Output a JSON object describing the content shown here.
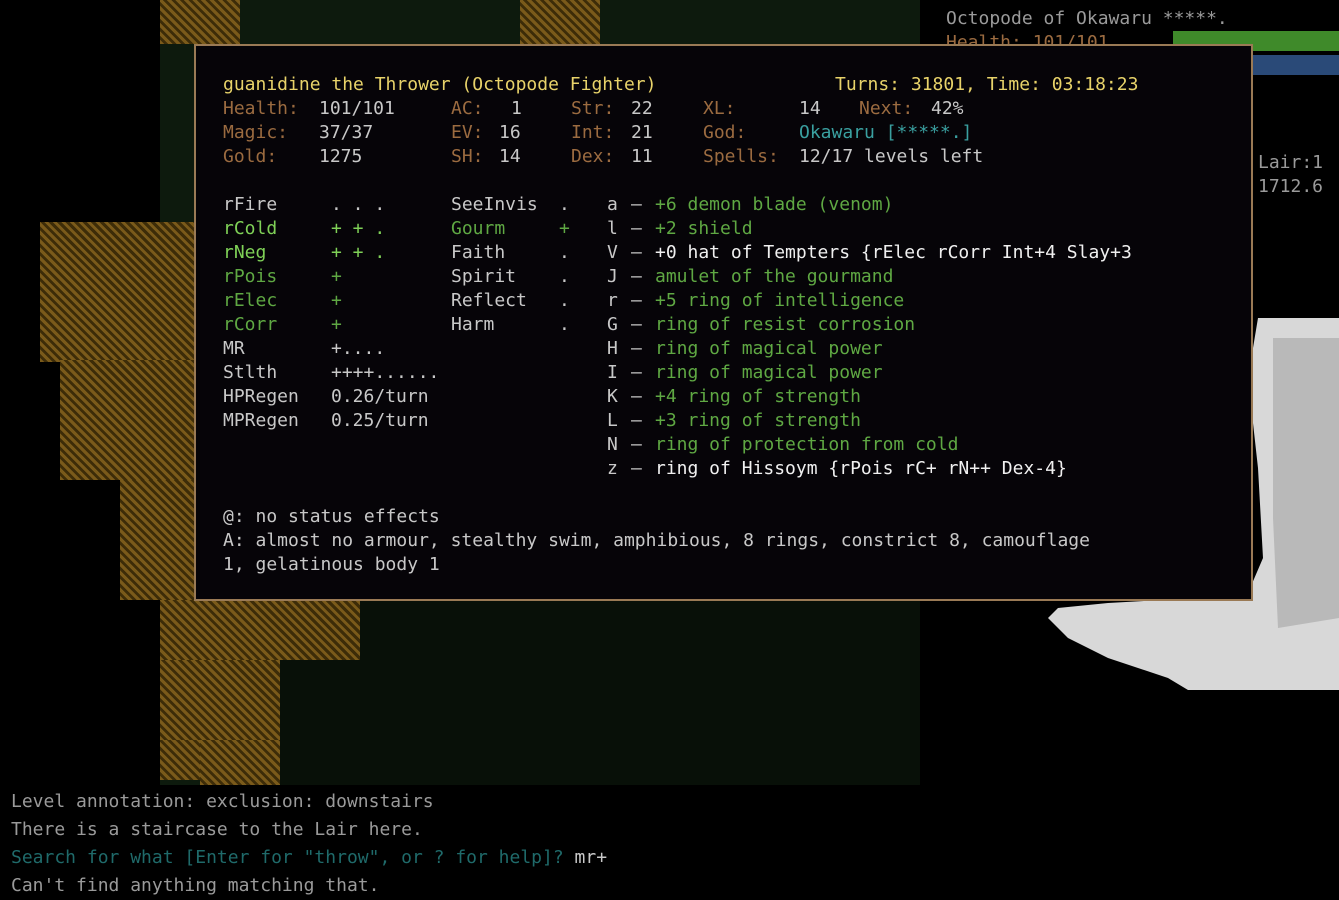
{
  "sidebar": {
    "title_line": "Octopode of Okawaru *****.",
    "health_line": "Health: 101/101",
    "place_fragment": "Lair:1",
    "time_fragment": "1712.6",
    "colors": {
      "health_bar": "#3f8a2a",
      "magic_bar": "#2a4a78"
    }
  },
  "overlay": {
    "character": "guanidine the Thrower (Octopode Fighter)",
    "turns": "Turns: 31801, Time: 03:18:23",
    "stats": {
      "health_label": "Health:",
      "health_value": "101/101",
      "magic_label": "Magic:",
      "magic_value": "37/37",
      "gold_label": "Gold:",
      "gold_value": "1275",
      "ac_label": "AC:",
      "ac_value": "1",
      "ev_label": "EV:",
      "ev_value": "16",
      "sh_label": "SH:",
      "sh_value": "14",
      "str_label": "Str:",
      "str_value": "22",
      "int_label": "Int:",
      "int_value": "21",
      "dex_label": "Dex:",
      "dex_value": "11",
      "xl_label": "XL:",
      "xl_value": "14",
      "next_label": "Next:",
      "next_value": "42%",
      "god_label": "God:",
      "god_value": "Okawaru [*****.]",
      "spells_label": "Spells:",
      "spells_value": "12/17 levels left"
    },
    "resists": [
      {
        "name": "rFire",
        "value": ". . .",
        "color": "lgray"
      },
      {
        "name": "rCold",
        "value": "+ + .",
        "color": "lgreen"
      },
      {
        "name": "rNeg",
        "value": "+ + .",
        "color": "lgreen"
      },
      {
        "name": "rPois",
        "value": "+",
        "color": "green"
      },
      {
        "name": "rElec",
        "value": "+",
        "color": "green"
      },
      {
        "name": "rCorr",
        "value": "+",
        "color": "green"
      },
      {
        "name": "MR",
        "value": "+....",
        "color": "lgray"
      },
      {
        "name": "Stlth",
        "value": "++++......",
        "color": "lgray"
      },
      {
        "name": "HPRegen",
        "value": "0.26/turn",
        "color": "lgray"
      },
      {
        "name": "MPRegen",
        "value": "0.25/turn",
        "color": "lgray"
      }
    ],
    "props": [
      {
        "name": "SeeInvis",
        "value": ".",
        "color": "lgray"
      },
      {
        "name": "Gourm",
        "value": "+",
        "color": "green"
      },
      {
        "name": "Faith",
        "value": ".",
        "color": "lgray"
      },
      {
        "name": "Spirit",
        "value": ".",
        "color": "lgray"
      },
      {
        "name": "Reflect",
        "value": ".",
        "color": "lgray"
      },
      {
        "name": "Harm",
        "value": ".",
        "color": "lgray"
      }
    ],
    "equipment": [
      {
        "slot": "a",
        "item": "+6 demon blade (venom)",
        "color": "green"
      },
      {
        "slot": "l",
        "item": "+2 shield",
        "color": "green"
      },
      {
        "slot": "V",
        "item": "+0 hat of Tempters {rElec rCorr Int+4 Slay+3",
        "color": "white"
      },
      {
        "slot": "J",
        "item": "amulet of the gourmand",
        "color": "green"
      },
      {
        "slot": "r",
        "item": "+5 ring of intelligence",
        "color": "green"
      },
      {
        "slot": "G",
        "item": "ring of resist corrosion",
        "color": "green"
      },
      {
        "slot": "H",
        "item": "ring of magical power",
        "color": "green"
      },
      {
        "slot": "I",
        "item": "ring of magical power",
        "color": "green"
      },
      {
        "slot": "K",
        "item": "+4 ring of strength",
        "color": "green"
      },
      {
        "slot": "L",
        "item": "+3 ring of strength",
        "color": "green"
      },
      {
        "slot": "N",
        "item": "ring of protection from cold",
        "color": "green"
      },
      {
        "slot": "z",
        "item": "ring of Hissoym {rPois rC+ rN++ Dex-4}",
        "color": "white"
      }
    ],
    "dash": "–",
    "status_line": "@: no status effects",
    "abilities_line1": "A: almost no armour, stealthy swim, amphibious, 8 rings, constrict 8, camouflage",
    "abilities_line2": "1, gelatinous body 1"
  },
  "messages": [
    {
      "text": "Level annotation: exclusion: downstairs",
      "color": "#9a9a9a"
    },
    {
      "text": "There is a staircase to the Lair here.",
      "color": "#9a9a9a"
    },
    {
      "text": "Search for what [Enter for \"throw\", or ? for help]?",
      "color": "#1f6a6a",
      "input": " mr+"
    },
    {
      "text": "Can't find anything matching that.",
      "color": "#9a9a9a"
    }
  ]
}
